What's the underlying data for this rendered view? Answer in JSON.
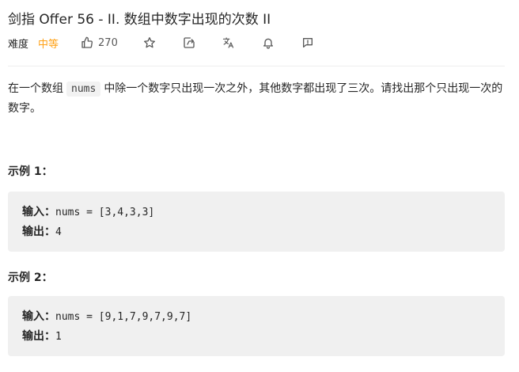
{
  "problem": {
    "title": "剑指 Offer 56 - II. 数组中数字出现的次数 II"
  },
  "meta": {
    "difficulty_label": "难度",
    "difficulty_value": "中等",
    "difficulty_color": "#ffa116",
    "like_count": "270",
    "icons": [
      "thumbs-up-icon",
      "star-icon",
      "share-icon",
      "translate-icon",
      "bell-icon",
      "feedback-icon"
    ]
  },
  "description": {
    "part1": "在一个数组",
    "code": "nums",
    "part2": "中除一个数字只出现一次之外，其他数字都出现了三次。请找出那个只出现一次的数字。"
  },
  "examples": [
    {
      "title": "示例 1：",
      "input_label": "输入：",
      "input_value": "nums = [3,4,3,3]",
      "output_label": "输出：",
      "output_value": "4"
    },
    {
      "title": "示例 2：",
      "input_label": "输入：",
      "input_value": "nums = [9,1,7,9,7,9,7]",
      "output_label": "输出：",
      "output_value": "1"
    }
  ]
}
